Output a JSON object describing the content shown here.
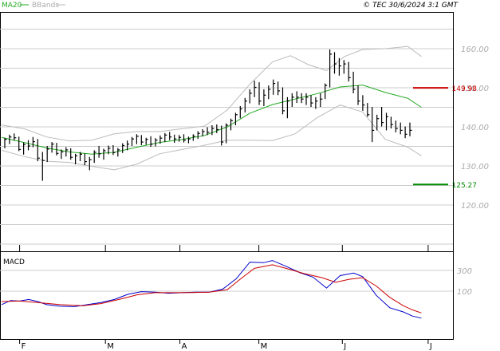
{
  "header": {
    "legend_ma": "MA20",
    "legend_bb": "BBands",
    "copyright": "© TEC 30/6/2024 3:1 GMT"
  },
  "colors": {
    "ma": "#22aa22",
    "bbands": "#bbbbbb",
    "resistance": "#cc0000",
    "support": "#008800",
    "macd": "#0000cc",
    "signal": "#cc0000",
    "bars": "#000000",
    "grid": "#cccccc"
  },
  "chart_data": [
    {
      "type": "ohlc",
      "title": "",
      "ylim": [
        110,
        170
      ],
      "y_ticks": [
        120,
        130,
        140,
        150,
        160
      ],
      "y_tick_labels": [
        "120.00",
        "130.00",
        "140.00",
        "150.00",
        "160.00"
      ],
      "x_ticks": [
        {
          "label": "F",
          "t": 0.04
        },
        {
          "label": "M",
          "t": 0.23
        },
        {
          "label": "A",
          "t": 0.395
        },
        {
          "label": "M",
          "t": 0.57
        },
        {
          "label": "J",
          "t": 0.755
        },
        {
          "label": "J",
          "t": 0.945
        }
      ],
      "price_bars": [
        [
          137.2,
          134.5,
          136.8
        ],
        [
          138.0,
          135.6,
          137.4
        ],
        [
          138.3,
          136.5,
          137.2
        ],
        [
          137.5,
          133.8,
          134.2
        ],
        [
          136.0,
          132.9,
          135.5
        ],
        [
          136.6,
          134.0,
          135.1
        ],
        [
          137.4,
          134.8,
          136.2
        ],
        [
          136.9,
          131.2,
          132.0
        ],
        [
          133.6,
          126.2,
          131.4
        ],
        [
          135.1,
          131.0,
          134.3
        ],
        [
          136.1,
          133.4,
          135.6
        ],
        [
          135.9,
          132.7,
          133.2
        ],
        [
          134.2,
          131.8,
          133.6
        ],
        [
          134.8,
          132.4,
          134.1
        ],
        [
          134.5,
          131.6,
          132.2
        ],
        [
          133.1,
          130.4,
          132.6
        ],
        [
          133.6,
          131.2,
          133.0
        ],
        [
          133.2,
          130.2,
          131.1
        ],
        [
          132.3,
          128.9,
          131.6
        ],
        [
          134.0,
          130.8,
          133.5
        ],
        [
          135.1,
          132.1,
          133.1
        ],
        [
          134.4,
          131.6,
          133.9
        ],
        [
          135.2,
          133.0,
          134.5
        ],
        [
          135.3,
          132.8,
          133.4
        ],
        [
          134.6,
          132.4,
          134.1
        ],
        [
          135.8,
          133.3,
          135.2
        ],
        [
          136.5,
          134.0,
          135.6
        ],
        [
          137.4,
          135.1,
          136.9
        ],
        [
          138.1,
          135.6,
          137.6
        ],
        [
          137.9,
          135.3,
          136.1
        ],
        [
          137.2,
          135.4,
          136.8
        ],
        [
          137.6,
          134.9,
          135.6
        ],
        [
          137.1,
          135.0,
          136.6
        ],
        [
          137.8,
          135.7,
          137.1
        ],
        [
          138.4,
          136.1,
          137.9
        ],
        [
          138.7,
          136.6,
          137.4
        ],
        [
          138.0,
          135.9,
          136.9
        ],
        [
          137.9,
          136.2,
          137.3
        ],
        [
          138.1,
          136.0,
          136.6
        ],
        [
          137.5,
          135.8,
          136.9
        ],
        [
          138.1,
          136.4,
          137.6
        ],
        [
          138.9,
          136.9,
          138.3
        ],
        [
          139.4,
          137.6,
          138.8
        ],
        [
          139.9,
          137.9,
          138.6
        ],
        [
          140.4,
          137.9,
          139.6
        ],
        [
          140.6,
          138.4,
          139.3
        ],
        [
          140.3,
          135.2,
          136.1
        ],
        [
          140.9,
          135.8,
          140.4
        ],
        [
          142.1,
          139.1,
          141.6
        ],
        [
          143.6,
          140.4,
          143.1
        ],
        [
          145.3,
          142.2,
          144.6
        ],
        [
          147.4,
          143.7,
          146.6
        ],
        [
          149.6,
          146.0,
          148.6
        ],
        [
          151.8,
          147.6,
          150.1
        ],
        [
          151.4,
          145.6,
          146.6
        ],
        [
          149.6,
          145.3,
          148.1
        ],
        [
          150.6,
          147.1,
          149.6
        ],
        [
          152.1,
          148.2,
          151.1
        ],
        [
          151.6,
          148.1,
          149.2
        ],
        [
          150.1,
          143.2,
          144.1
        ],
        [
          147.6,
          142.2,
          146.6
        ],
        [
          148.6,
          145.1,
          147.6
        ],
        [
          149.1,
          146.1,
          147.6
        ],
        [
          148.6,
          146.1,
          147.1
        ],
        [
          148.6,
          145.6,
          147.6
        ],
        [
          148.1,
          145.1,
          146.1
        ],
        [
          147.6,
          144.6,
          146.6
        ],
        [
          148.6,
          145.1,
          147.1
        ],
        [
          151.1,
          147.1,
          150.6
        ],
        [
          159.8,
          150.1,
          158.6
        ],
        [
          159.1,
          153.6,
          156.1
        ],
        [
          157.6,
          153.1,
          155.6
        ],
        [
          157.1,
          153.6,
          156.1
        ],
        [
          156.6,
          151.6,
          152.6
        ],
        [
          154.1,
          148.6,
          149.6
        ],
        [
          150.6,
          145.6,
          146.6
        ],
        [
          148.1,
          144.1,
          145.6
        ],
        [
          146.1,
          142.6,
          143.1
        ],
        [
          145.1,
          136.1,
          139.1
        ],
        [
          143.1,
          139.1,
          142.1
        ],
        [
          145.1,
          140.1,
          141.1
        ],
        [
          143.6,
          139.1,
          142.6
        ],
        [
          142.6,
          139.6,
          140.6
        ],
        [
          141.6,
          138.6,
          139.6
        ],
        [
          141.1,
          138.1,
          139.1
        ],
        [
          140.1,
          137.1,
          138.1
        ],
        [
          141.1,
          137.6,
          139.1
        ]
      ],
      "ma20": [
        [
          0.0,
          137.3
        ],
        [
          0.05,
          136.0
        ],
        [
          0.1,
          134.6
        ],
        [
          0.15,
          133.6
        ],
        [
          0.2,
          133.0
        ],
        [
          0.25,
          133.5
        ],
        [
          0.3,
          134.8
        ],
        [
          0.35,
          136.0
        ],
        [
          0.4,
          136.8
        ],
        [
          0.45,
          137.8
        ],
        [
          0.5,
          140.0
        ],
        [
          0.55,
          143.5
        ],
        [
          0.6,
          145.7
        ],
        [
          0.65,
          147.1
        ],
        [
          0.7,
          148.5
        ],
        [
          0.75,
          150.2
        ],
        [
          0.8,
          150.7
        ],
        [
          0.85,
          148.8
        ],
        [
          0.9,
          147.3
        ],
        [
          0.93,
          145.0
        ]
      ],
      "bb_upper": [
        [
          0.0,
          140.5
        ],
        [
          0.05,
          139.5
        ],
        [
          0.1,
          137.4
        ],
        [
          0.15,
          136.4
        ],
        [
          0.2,
          136.6
        ],
        [
          0.25,
          138.2
        ],
        [
          0.3,
          138.8
        ],
        [
          0.35,
          138.8
        ],
        [
          0.4,
          139.5
        ],
        [
          0.45,
          140.2
        ],
        [
          0.5,
          144.3
        ],
        [
          0.55,
          150.9
        ],
        [
          0.6,
          156.6
        ],
        [
          0.64,
          158.2
        ],
        [
          0.68,
          155.9
        ],
        [
          0.72,
          154.4
        ],
        [
          0.76,
          158.0
        ],
        [
          0.8,
          159.8
        ],
        [
          0.85,
          160.0
        ],
        [
          0.9,
          160.6
        ],
        [
          0.93,
          158.0
        ]
      ],
      "bb_lower": [
        [
          0.0,
          134.0
        ],
        [
          0.05,
          132.4
        ],
        [
          0.1,
          131.2
        ],
        [
          0.15,
          130.9
        ],
        [
          0.2,
          129.9
        ],
        [
          0.25,
          129.0
        ],
        [
          0.3,
          130.5
        ],
        [
          0.35,
          133.1
        ],
        [
          0.4,
          134.2
        ],
        [
          0.45,
          135.3
        ],
        [
          0.5,
          136.6
        ],
        [
          0.55,
          136.6
        ],
        [
          0.6,
          136.5
        ],
        [
          0.65,
          138.2
        ],
        [
          0.7,
          142.4
        ],
        [
          0.75,
          145.6
        ],
        [
          0.8,
          143.8
        ],
        [
          0.85,
          136.8
        ],
        [
          0.9,
          134.8
        ],
        [
          0.93,
          132.6
        ]
      ],
      "levels": [
        {
          "name": "resistance",
          "value": 149.98,
          "label": "149.98"
        },
        {
          "name": "support",
          "value": 125.27,
          "label": "125.27"
        }
      ]
    },
    {
      "type": "line",
      "title": "MACD",
      "ylim": [
        -300,
        600
      ],
      "y_ticks": [
        100,
        300
      ],
      "y_tick_labels": [
        "100",
        "300"
      ],
      "series": [
        {
          "key": "macd",
          "points": [
            [
              0.0,
              -30
            ],
            [
              0.02,
              10
            ],
            [
              0.04,
              5
            ],
            [
              0.06,
              20
            ],
            [
              0.08,
              0
            ],
            [
              0.1,
              -30
            ],
            [
              0.13,
              -45
            ],
            [
              0.16,
              -50
            ],
            [
              0.19,
              -30
            ],
            [
              0.22,
              -10
            ],
            [
              0.25,
              20
            ],
            [
              0.28,
              70
            ],
            [
              0.31,
              95
            ],
            [
              0.34,
              90
            ],
            [
              0.37,
              80
            ],
            [
              0.4,
              85
            ],
            [
              0.43,
              90
            ],
            [
              0.46,
              90
            ],
            [
              0.49,
              120
            ],
            [
              0.52,
              220
            ],
            [
              0.55,
              380
            ],
            [
              0.58,
              375
            ],
            [
              0.6,
              395
            ],
            [
              0.63,
              340
            ],
            [
              0.66,
              280
            ],
            [
              0.69,
              235
            ],
            [
              0.72,
              130
            ],
            [
              0.75,
              250
            ],
            [
              0.78,
              275
            ],
            [
              0.8,
              240
            ],
            [
              0.83,
              60
            ],
            [
              0.86,
              -60
            ],
            [
              0.89,
              -100
            ],
            [
              0.91,
              -140
            ],
            [
              0.93,
              -160
            ]
          ]
        },
        {
          "key": "signal",
          "points": [
            [
              0.0,
              0
            ],
            [
              0.04,
              5
            ],
            [
              0.08,
              -10
            ],
            [
              0.13,
              -30
            ],
            [
              0.18,
              -40
            ],
            [
              0.22,
              -20
            ],
            [
              0.26,
              20
            ],
            [
              0.3,
              65
            ],
            [
              0.34,
              85
            ],
            [
              0.38,
              85
            ],
            [
              0.42,
              87
            ],
            [
              0.46,
              90
            ],
            [
              0.5,
              115
            ],
            [
              0.53,
              220
            ],
            [
              0.56,
              320
            ],
            [
              0.6,
              355
            ],
            [
              0.63,
              320
            ],
            [
              0.67,
              270
            ],
            [
              0.71,
              230
            ],
            [
              0.74,
              185
            ],
            [
              0.77,
              215
            ],
            [
              0.8,
              230
            ],
            [
              0.83,
              150
            ],
            [
              0.86,
              40
            ],
            [
              0.89,
              -40
            ],
            [
              0.91,
              -80
            ],
            [
              0.93,
              -110
            ]
          ]
        }
      ]
    }
  ]
}
